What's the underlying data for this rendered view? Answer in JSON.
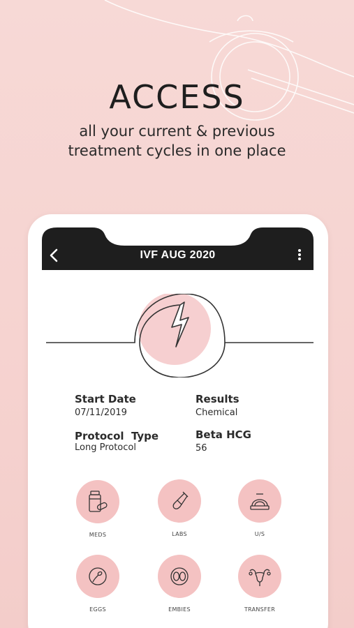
{
  "hero": {
    "title": "ACCESS",
    "subtitle_line1": "all your current & previous",
    "subtitle_line2": "treatment cycles in one place"
  },
  "app": {
    "title": "IVF AUG 2020",
    "back_icon": "chevron-left-icon",
    "menu_icon": "more-vertical-icon"
  },
  "details": {
    "start_date": {
      "label": "Start Date",
      "value": "07/11/2019"
    },
    "results": {
      "label": "Results",
      "value": "Chemical"
    },
    "protocol_type": {
      "label": "Protocol  Type",
      "value": "Long Protocol"
    },
    "beta_hcg": {
      "label": "Beta HCG",
      "value": "56"
    }
  },
  "categories": [
    {
      "label": "MEDS",
      "icon": "pill-bottle-icon"
    },
    {
      "label": "LABS",
      "icon": "test-tube-icon"
    },
    {
      "label": "U/S",
      "icon": "ultrasound-icon"
    },
    {
      "label": "EGGS",
      "icon": "egg-sperm-icon"
    },
    {
      "label": "EMBIES",
      "icon": "embryo-icon"
    },
    {
      "label": "TRANSFER",
      "icon": "uterus-icon"
    }
  ],
  "colors": {
    "background": "#f6d3d0",
    "appbar": "#1e1e1e",
    "accent_pink": "#f4c2c2",
    "text": "#2b2b2b"
  }
}
